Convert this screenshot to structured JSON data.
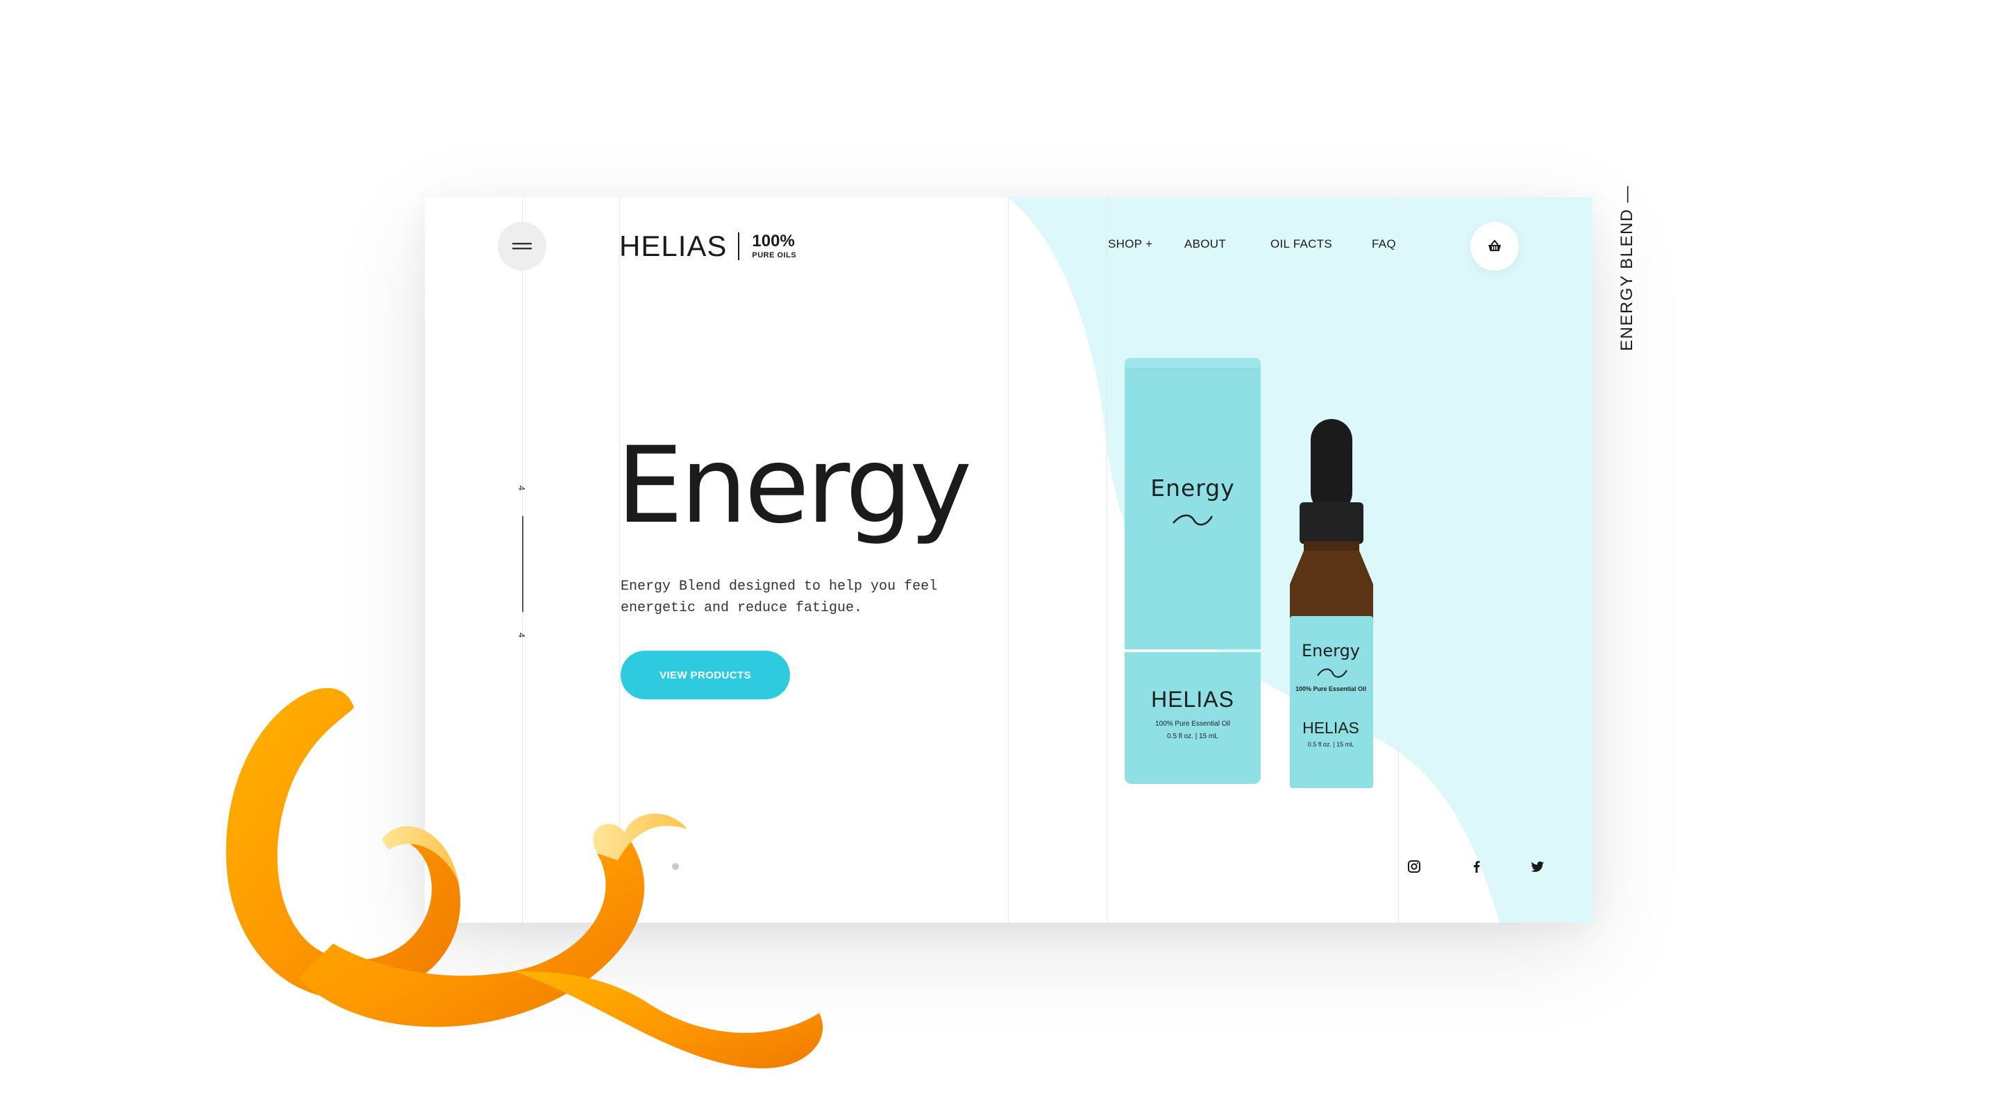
{
  "brand": {
    "name": "HELIAS",
    "percent": "100%",
    "tagline": "PURE OILS"
  },
  "nav": {
    "items": [
      "SHOP +",
      "ABOUT",
      "OIL FACTS",
      "FAQ"
    ]
  },
  "slider": {
    "current": "4",
    "total": "4",
    "progress": 1.0
  },
  "hero": {
    "title": "Energy",
    "description": "Energy Blend designed to help you feel energetic and reduce fatigue.",
    "cta_label": "VIEW PRODUCTS"
  },
  "product": {
    "tube_title": "Energy",
    "tube_brand": "HELIAS",
    "tube_sub": "100% Pure Essential Oil",
    "tube_volume": "0.5 fl oz. | 15 mL",
    "bottle_title": "Energy",
    "bottle_sub": "100% Pure Essential Oil",
    "bottle_brand": "HELIAS",
    "bottle_volume": "0.5 fl oz. | 15 mL"
  },
  "social": [
    "instagram-icon",
    "facebook-icon",
    "twitter-icon"
  ],
  "side_label": "ENERGY BLEND —",
  "colors": {
    "accent": "#2ECBE0",
    "blob": "#DDF8FB",
    "tube": "#8FE0E4",
    "text": "#1A1A1A"
  }
}
